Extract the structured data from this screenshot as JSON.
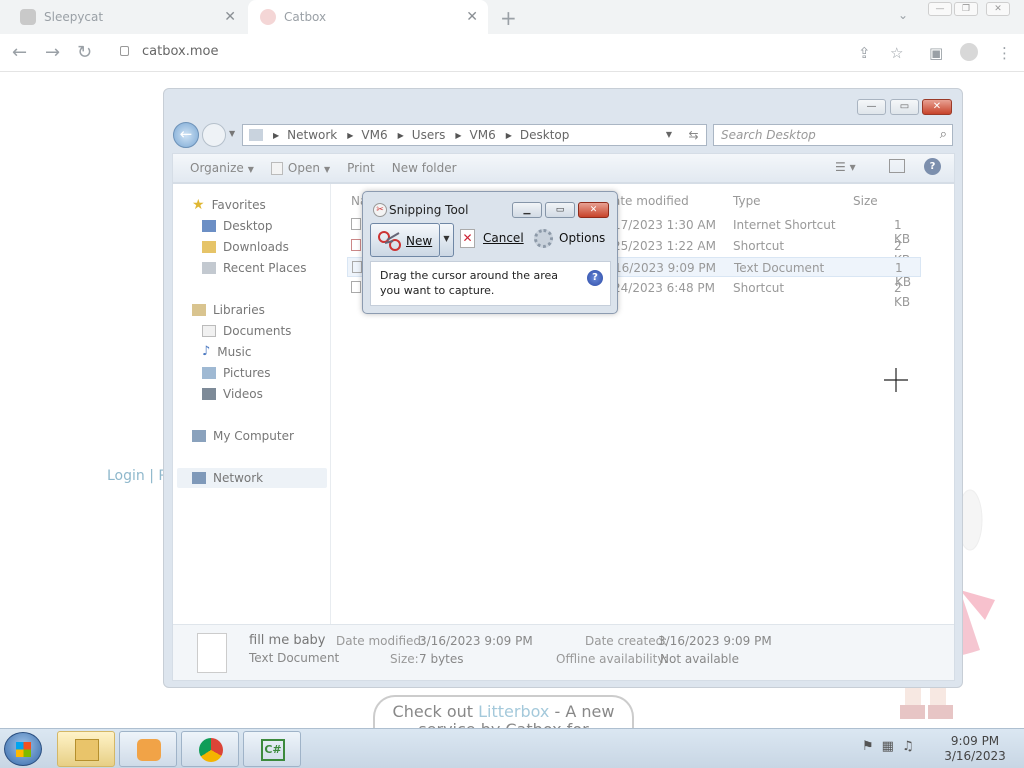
{
  "browser": {
    "tabs": [
      {
        "title": "Sleepycat",
        "active": false
      },
      {
        "title": "Catbox",
        "active": true
      }
    ],
    "new_tab_symbol": "+",
    "url": "catbox.moe",
    "nav_icons": [
      "back-arrow-icon",
      "forward-arrow-icon",
      "reload-icon"
    ],
    "right_icons": [
      "share-icon",
      "star-icon",
      "sidepanel-icon",
      "profile-icon",
      "menu-icon"
    ]
  },
  "page": {
    "login_text": "Login | R",
    "litterbox": {
      "prefix": "Check out ",
      "link": "Litterbox",
      "suffix": " - A new",
      "line2": "service by Catbox for temporary"
    }
  },
  "explorer": {
    "breadcrumb": [
      "Network",
      "VM6",
      "Users",
      "VM6",
      "Desktop"
    ],
    "search_placeholder": "Search Desktop",
    "toolbar": {
      "organize": "Organize",
      "open": "Open",
      "print": "Print",
      "new_folder": "New folder"
    },
    "nav": {
      "favorites": "Favorites",
      "desktop": "Desktop",
      "downloads": "Downloads",
      "recent": "Recent Places",
      "libraries": "Libraries",
      "documents": "Documents",
      "music": "Music",
      "pictures": "Pictures",
      "videos": "Videos",
      "computer": "My Computer",
      "network": "Network"
    },
    "columns": {
      "name": "Na",
      "date": "ate modified",
      "type": "Type",
      "size": "Size"
    },
    "files": [
      {
        "date": "17/2023 1:30 AM",
        "type": "Internet Shortcut",
        "size": "1 KB"
      },
      {
        "date": "25/2023 1:22 AM",
        "type": "Shortcut",
        "size": "2 KB"
      },
      {
        "date": "16/2023 9:09 PM",
        "type": "Text Document",
        "size": "1 KB"
      },
      {
        "date": "24/2023 6:48 PM",
        "type": "Shortcut",
        "size": "2 KB"
      }
    ],
    "details": {
      "name": "fill me baby",
      "kind": "Text Document",
      "date_modified_label": "Date modified:",
      "date_modified": "3/16/2023 9:09 PM",
      "size_label": "Size:",
      "size": "7 bytes",
      "date_created_label": "Date created:",
      "date_created": "3/16/2023 9:09 PM",
      "offline_label": "Offline availability:",
      "offline": "Not available"
    }
  },
  "snipping_tool": {
    "title": "Snipping Tool",
    "new_label": "New",
    "cancel_label": "Cancel",
    "options_label": "Options",
    "message_line1": "Drag the cursor around the area",
    "message_line2": "you want to capture.",
    "help_symbol": "?"
  },
  "taskbar": {
    "time": "9:09 PM",
    "date": "3/16/2023",
    "apps": [
      "explorer-icon",
      "media-player-icon",
      "chrome-icon",
      "csharp-icon"
    ]
  }
}
